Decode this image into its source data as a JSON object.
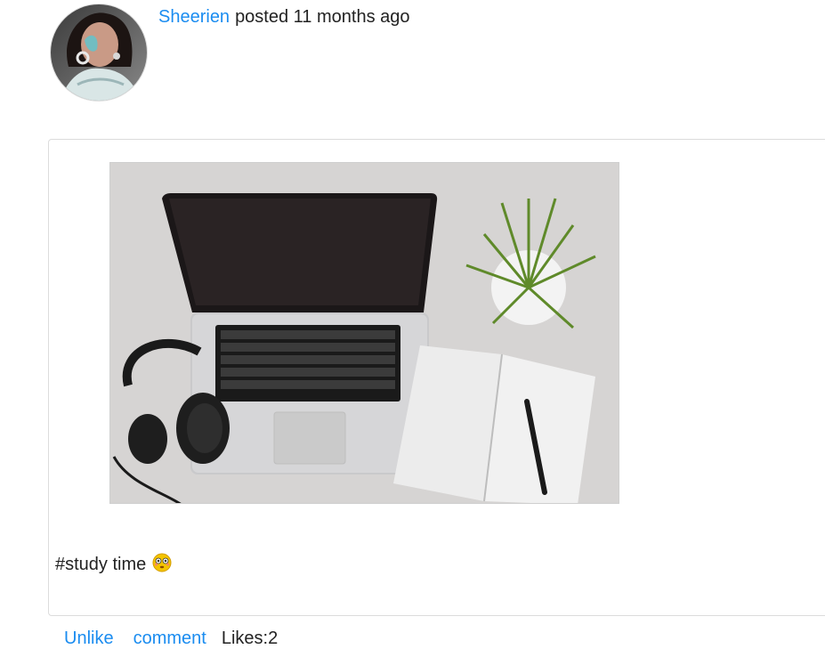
{
  "post": {
    "author": "Sheerien",
    "meta": "posted 11 months ago",
    "caption": "#study time",
    "image_icon": "laptop-desk-photo",
    "emoji_icon": "flushed-face-emoji"
  },
  "actions": {
    "unlike_label": "Unlike",
    "comment_label": "comment",
    "likes_text": "Likes:2"
  },
  "colors": {
    "link": "#1a8cf0",
    "text": "#222222",
    "border": "#dcdcdc"
  }
}
